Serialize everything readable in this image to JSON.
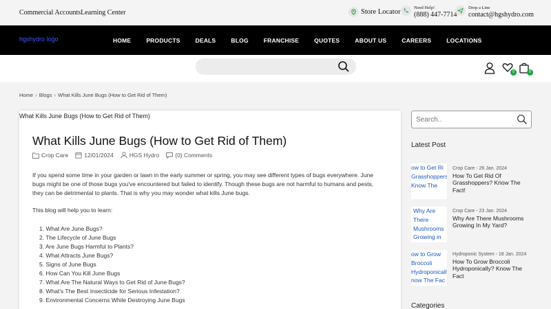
{
  "topbar": {
    "links": [
      "Commercial Accounts",
      "Learning Center"
    ],
    "store_locator": "Store Locator",
    "need_help_label": "Need Help!",
    "phone": "(888) 447-7714",
    "drop_line_label": "Drop a Line",
    "email": "contact@hgshydro.com"
  },
  "nav": {
    "logo_alt": "hgshydro logo",
    "items": [
      "HOME",
      "PRODUCTS",
      "DEALS",
      "BLOG",
      "FRANCHISE",
      "QUOTES",
      "ABOUT US",
      "CAREERS",
      "LOCATIONS"
    ]
  },
  "header": {
    "search_placeholder": "",
    "wishlist_count": "0",
    "cart_count": "0"
  },
  "breadcrumb": [
    "Home",
    "Blogs",
    "What Kills June Bugs (How to Get Rid of Them)"
  ],
  "page_title": "What Kills June Bugs (How to Get Rid of Them)",
  "article": {
    "title": "What Kills June Bugs (How to Get Rid of Them)",
    "category": "Crop Care",
    "date": "12/01/2024",
    "author": "HGS Hydro",
    "comments": "(0) Comments",
    "intro": "If you spend some time in your garden or lawn in the early summer or spring, you may see different types of bugs everywhere. June bugs might be one of those bugs you've encountered but failed to identify. Though these bugs are not harmful to humans and pests, they can be detrimental to plants. That is why you may wonder what kills June bugs.",
    "learn": "This blog will help you to learn:",
    "toc": [
      "What Are June Bugs?",
      "The Lifecycle of June Bugs",
      "Are June Bugs Harmful to Plants?",
      "What Attracts June Bugs?",
      "Signs of June Bugs",
      "How Can You Kill June Bugs",
      "What Are The Natural Ways to Get Rid of June Bugs?",
      "What's The Best Insecticide for Serious Infestation?",
      "Environmental Concerns While Destroying June Bugs"
    ]
  },
  "sidebar": {
    "search_placeholder": "Search..",
    "latest_post_heading": "Latest Post",
    "posts": [
      {
        "thumb_lines": [
          "ow to Get Ri",
          "Grasshoppers",
          "Know The"
        ],
        "category_date": "Crop Care - 26 Jan. 2024",
        "title": "How To Get Rid Of Grasshoppers? Know The Fact!"
      },
      {
        "thumb_lines": [
          "Why Are",
          "There",
          "Mushrooms",
          "Growing in"
        ],
        "category_date": "Crop Care - 23 Jan. 2024",
        "title": "Why Are There Mushrooms Growing In My Yard?"
      },
      {
        "thumb_lines": [
          "ow to Grow",
          "Broccoli",
          "Hydroponically",
          "now The Fac"
        ],
        "category_date": "Hydroponic System - 18 Jan. 2024",
        "title": "How To Grow Broccoli Hydroponically? Know The Fact"
      }
    ],
    "categories_heading": "Categories"
  }
}
